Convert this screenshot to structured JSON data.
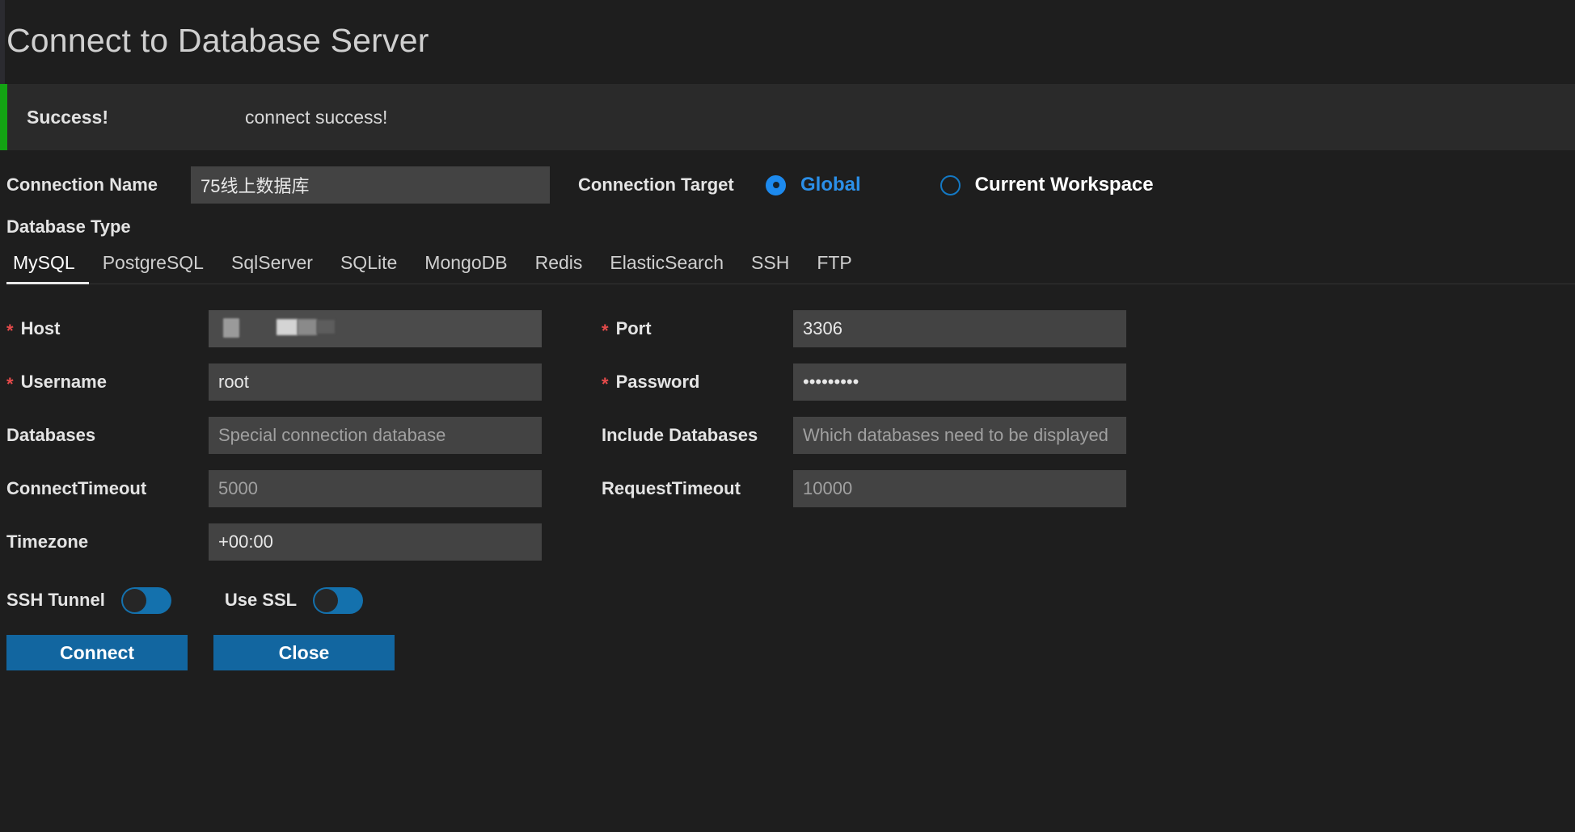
{
  "window": {
    "title": "Connect to Database Server"
  },
  "banner": {
    "title": "Success!",
    "message": "connect success!",
    "accent_color": "#13a313"
  },
  "connection": {
    "name_label": "Connection Name",
    "name_value": "75线上数据库",
    "target_label": "Connection Target",
    "targets": [
      {
        "label": "Global",
        "selected": true
      },
      {
        "label": "Current Workspace",
        "selected": false
      }
    ]
  },
  "database_type": {
    "label": "Database Type",
    "active": "MySQL",
    "tabs": [
      "MySQL",
      "PostgreSQL",
      "SqlServer",
      "SQLite",
      "MongoDB",
      "Redis",
      "ElasticSearch",
      "SSH",
      "FTP"
    ]
  },
  "fields": {
    "host": {
      "label": "Host",
      "required": true,
      "value": "",
      "redacted": true
    },
    "port": {
      "label": "Port",
      "required": true,
      "value": "3306"
    },
    "username": {
      "label": "Username",
      "required": true,
      "value": "root"
    },
    "password": {
      "label": "Password",
      "required": true,
      "value": "•••••••••"
    },
    "databases": {
      "label": "Databases",
      "required": false,
      "value": "",
      "placeholder": "Special connection database"
    },
    "include_databases": {
      "label": "Include Databases",
      "required": false,
      "value": "",
      "placeholder": "Which databases need to be displayed"
    },
    "connect_timeout": {
      "label": "ConnectTimeout",
      "required": false,
      "value": "",
      "placeholder": "5000"
    },
    "request_timeout": {
      "label": "RequestTimeout",
      "required": false,
      "value": "",
      "placeholder": "10000"
    },
    "timezone": {
      "label": "Timezone",
      "required": false,
      "value": "+00:00"
    }
  },
  "toggles": {
    "ssh_tunnel": {
      "label": "SSH Tunnel",
      "on": false
    },
    "use_ssl": {
      "label": "Use SSL",
      "on": false
    },
    "accent_color": "#1471ad"
  },
  "actions": {
    "connect_label": "Connect",
    "close_label": "Close",
    "button_color": "#1266a0"
  }
}
